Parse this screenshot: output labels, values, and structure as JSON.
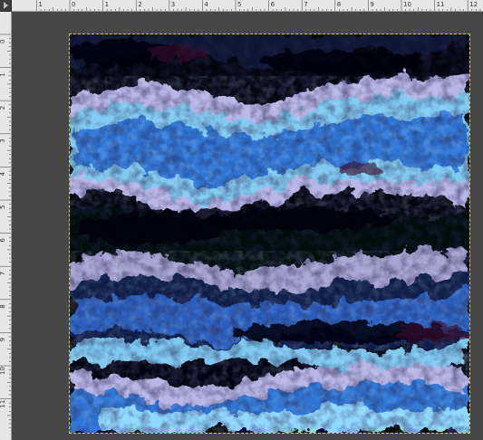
{
  "app": {
    "ruler_unit": "inches"
  },
  "ruler_top": {
    "labels": [
      "1",
      "0",
      "1",
      "2",
      "3",
      "4",
      "5",
      "6",
      "7",
      "8",
      "9",
      "10",
      "11",
      "12"
    ]
  },
  "ruler_left": {
    "labels": [
      "0",
      "1",
      "2",
      "3",
      "4",
      "5",
      "6",
      "7",
      "8",
      "9",
      "10",
      "11"
    ]
  },
  "canvas": {
    "description_colors": {
      "deep": "#050510",
      "navy": "#0b1a4a",
      "blue": "#2f74d6",
      "cyan": "#8fd8ff",
      "lilac": "#b9b4e6",
      "magenta": "#3b0f2e"
    }
  }
}
